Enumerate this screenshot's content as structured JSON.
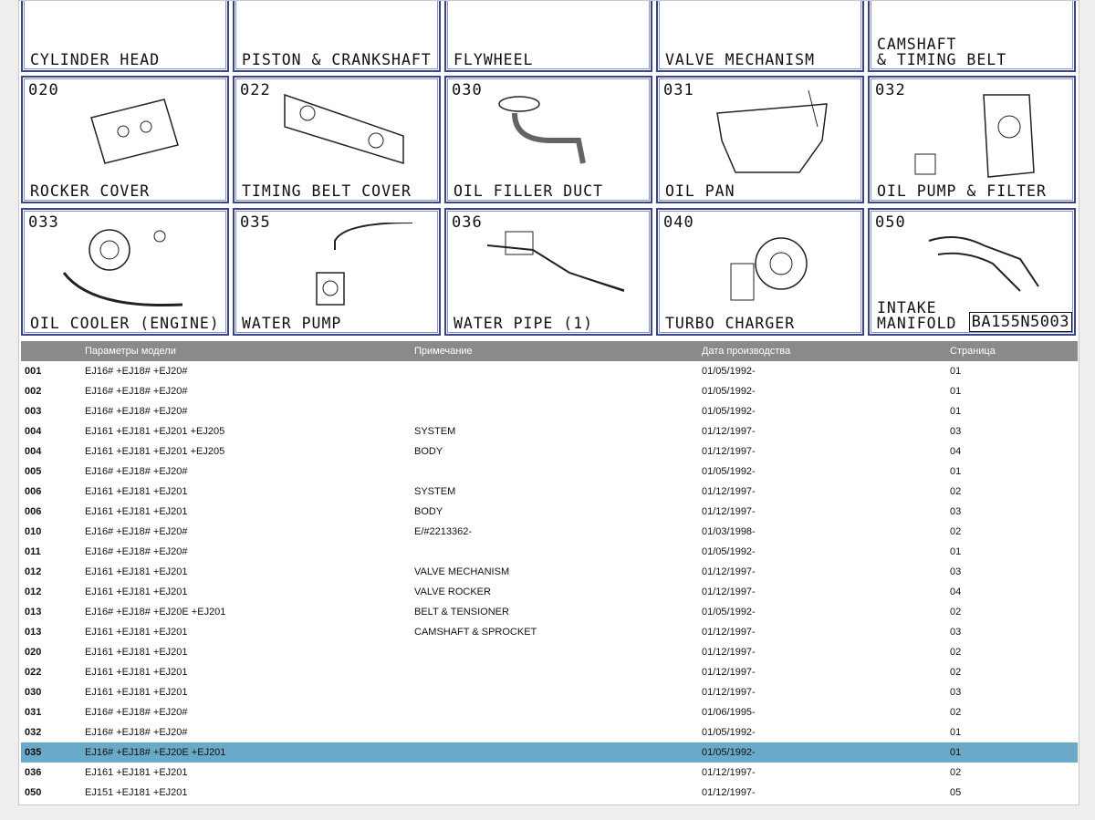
{
  "grid": {
    "cells": [
      {
        "code": "",
        "label": "CYLINDER HEAD",
        "icon": "cylinder-head-drawing"
      },
      {
        "code": "",
        "label": "PISTON & CRANKSHAFT",
        "icon": "piston-crankshaft-drawing"
      },
      {
        "code": "",
        "label": "FLYWHEEL",
        "icon": "flywheel-drawing"
      },
      {
        "code": "",
        "label": "VALVE MECHANISM",
        "icon": "valve-mechanism-drawing"
      },
      {
        "code": "",
        "label": "CAMSHAFT\n& TIMING BELT",
        "icon": "camshaft-drawing"
      },
      {
        "code": "020",
        "label": "ROCKER COVER",
        "icon": "rocker-cover-drawing"
      },
      {
        "code": "022",
        "label": "TIMING BELT COVER",
        "icon": "timing-belt-cover-drawing"
      },
      {
        "code": "030",
        "label": "OIL FILLER DUCT",
        "icon": "oil-filler-duct-drawing"
      },
      {
        "code": "031",
        "label": "OIL PAN",
        "icon": "oil-pan-drawing"
      },
      {
        "code": "032",
        "label": "OIL PUMP & FILTER",
        "icon": "oil-pump-drawing"
      },
      {
        "code": "033",
        "label": "OIL COOLER (ENGINE)",
        "icon": "oil-cooler-drawing"
      },
      {
        "code": "035",
        "label": "WATER PUMP",
        "icon": "water-pump-drawing"
      },
      {
        "code": "036",
        "label": "WATER PIPE (1)",
        "icon": "water-pipe-drawing"
      },
      {
        "code": "040",
        "label": "TURBO CHARGER",
        "icon": "turbo-charger-drawing"
      },
      {
        "code": "050",
        "label": "INTAKE\nMANIFOLD",
        "icon": "intake-manifold-drawing"
      }
    ],
    "stamp": "BA155N5003"
  },
  "table": {
    "headers": [
      "",
      "Параметры модели",
      "Примечание",
      "Дата производства",
      "Страница"
    ],
    "selected_row": 19,
    "selected_color": "#6aa9c8",
    "rows": [
      {
        "num": "001",
        "model": "EJ16# +EJ18# +EJ20#",
        "note": "",
        "date": "01/05/1992-",
        "page": "01"
      },
      {
        "num": "002",
        "model": "EJ16# +EJ18# +EJ20#",
        "note": "",
        "date": "01/05/1992-",
        "page": "01"
      },
      {
        "num": "003",
        "model": "EJ16# +EJ18# +EJ20#",
        "note": "",
        "date": "01/05/1992-",
        "page": "01"
      },
      {
        "num": "004",
        "model": "EJ161 +EJ181 +EJ201 +EJ205",
        "note": "SYSTEM",
        "date": "01/12/1997-",
        "page": "03"
      },
      {
        "num": "004",
        "model": "EJ161 +EJ181 +EJ201 +EJ205",
        "note": "BODY",
        "date": "01/12/1997-",
        "page": "04"
      },
      {
        "num": "005",
        "model": "EJ16# +EJ18# +EJ20#",
        "note": "",
        "date": "01/05/1992-",
        "page": "01"
      },
      {
        "num": "006",
        "model": "EJ161 +EJ181 +EJ201",
        "note": "SYSTEM",
        "date": "01/12/1997-",
        "page": "02"
      },
      {
        "num": "006",
        "model": "EJ161 +EJ181 +EJ201",
        "note": "BODY",
        "date": "01/12/1997-",
        "page": "03"
      },
      {
        "num": "010",
        "model": "EJ16# +EJ18# +EJ20#",
        "note": "E/#2213362-",
        "date": "01/03/1998-",
        "page": "02"
      },
      {
        "num": "011",
        "model": "EJ16# +EJ18# +EJ20#",
        "note": "",
        "date": "01/05/1992-",
        "page": "01"
      },
      {
        "num": "012",
        "model": "EJ161 +EJ181 +EJ201",
        "note": "VALVE MECHANISM",
        "date": "01/12/1997-",
        "page": "03"
      },
      {
        "num": "012",
        "model": "EJ161 +EJ181 +EJ201",
        "note": "VALVE ROCKER",
        "date": "01/12/1997-",
        "page": "04"
      },
      {
        "num": "013",
        "model": "EJ16# +EJ18# +EJ20E +EJ201",
        "note": "BELT & TENSIONER",
        "date": "01/05/1992-",
        "page": "02"
      },
      {
        "num": "013",
        "model": "EJ161 +EJ181 +EJ201",
        "note": "CAMSHAFT & SPROCKET",
        "date": "01/12/1997-",
        "page": "03"
      },
      {
        "num": "020",
        "model": "EJ161 +EJ181 +EJ201",
        "note": "",
        "date": "01/12/1997-",
        "page": "02"
      },
      {
        "num": "022",
        "model": "EJ161 +EJ181 +EJ201",
        "note": "",
        "date": "01/12/1997-",
        "page": "02"
      },
      {
        "num": "030",
        "model": "EJ161 +EJ181 +EJ201",
        "note": "",
        "date": "01/12/1997-",
        "page": "03"
      },
      {
        "num": "031",
        "model": "EJ16# +EJ18# +EJ20#",
        "note": "",
        "date": "01/06/1995-",
        "page": "02"
      },
      {
        "num": "032",
        "model": "EJ16# +EJ18# +EJ20#",
        "note": "",
        "date": "01/05/1992-",
        "page": "01"
      },
      {
        "num": "035",
        "model": "EJ16# +EJ18# +EJ20E +EJ201",
        "note": "",
        "date": "01/05/1992-",
        "page": "01"
      },
      {
        "num": "036",
        "model": "EJ161 +EJ181 +EJ201",
        "note": "",
        "date": "01/12/1997-",
        "page": "02"
      },
      {
        "num": "050",
        "model": "EJ151 +EJ181 +EJ201",
        "note": "",
        "date": "01/12/1997-",
        "page": "05"
      }
    ]
  }
}
